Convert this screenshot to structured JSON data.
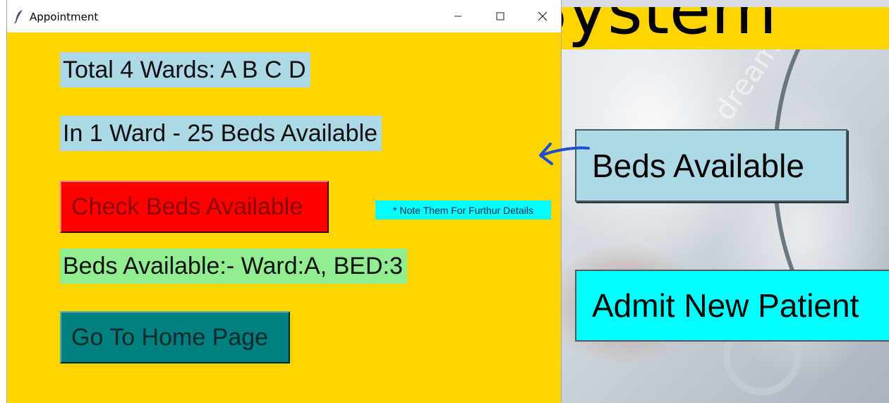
{
  "colors": {
    "dialog_bg": "#ffd400",
    "label_blue": "#add8e6",
    "label_green": "#90ee90",
    "button_red": "#ff0000",
    "button_teal": "#008080",
    "note_cyan": "#00ffff",
    "arrow": "#1f4fd1"
  },
  "dialog": {
    "title": "Appointment",
    "app_icon": "feather-icon",
    "controls": {
      "minimize_icon": "minimize-icon",
      "maximize_icon": "maximize-icon",
      "close_icon": "close-icon"
    },
    "labels": {
      "wards": "Total 4 Wards: A B C D",
      "beds_per_ward": "In 1 Ward - 25 Beds Available",
      "result": "Beds Available:- Ward:A, BED:3"
    },
    "buttons": {
      "check": "Check Beds Available",
      "home": "Go To Home Page"
    },
    "note": "* Note Them For Furthur Details"
  },
  "background_window": {
    "title_fragment": "t System",
    "watermark": "dream",
    "buttons": {
      "beds": "Beds Available",
      "admit": "Admit New Patient"
    },
    "annotation_icon": "arrow-left-icon"
  }
}
